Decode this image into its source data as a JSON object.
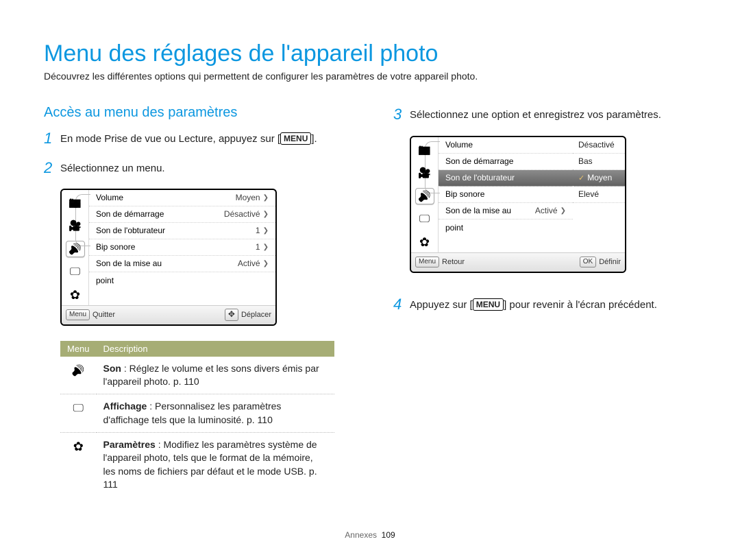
{
  "title": "Menu des réglages de l'appareil photo",
  "intro": "Découvrez les différentes options qui permettent de configurer les paramètres de votre appareil photo.",
  "subhead": "Accès au menu des paramètres",
  "steps": {
    "s1a": "En mode Prise de vue ou Lecture, appuyez sur [",
    "s1b": "].",
    "menu_btn": "MENU",
    "s2": "Sélectionnez un menu.",
    "s3": "Sélectionnez une option et enregistrez vos paramètres.",
    "s4a": "Appuyez sur [",
    "s4b": "] pour revenir à l'écran précédent."
  },
  "screen1": {
    "rows": [
      {
        "label": "Volume",
        "value": "Moyen",
        "chev": true
      },
      {
        "label": "Son de démarrage",
        "value": "Désactivé",
        "chev": true
      },
      {
        "label": "Son de l'obturateur",
        "value": "1",
        "chev": true
      },
      {
        "label": "Bip sonore",
        "value": "1",
        "chev": true
      },
      {
        "label": "Son de la mise au",
        "value": "Activé",
        "chev": true
      },
      {
        "label": "point",
        "value": "",
        "chev": false
      }
    ],
    "footer_left_btn": "Menu",
    "footer_left": "Quitter",
    "footer_right": "Déplacer"
  },
  "screen2": {
    "rows": [
      {
        "label": "Volume",
        "value": ""
      },
      {
        "label": "Son de démarrage",
        "value": ""
      },
      {
        "label": "Son de l'obturateur",
        "value": "",
        "active": true
      },
      {
        "label": "Bip sonore",
        "value": ""
      },
      {
        "label": "Son de la mise au",
        "value": "Activé",
        "chev": true
      },
      {
        "label": "point",
        "value": ""
      }
    ],
    "options": [
      "Désactivé",
      "Bas",
      "Moyen",
      "Elevé"
    ],
    "options_active_index": 2,
    "footer_left_btn": "Menu",
    "footer_left": "Retour",
    "footer_right_btn": "OK",
    "footer_right": "Définir"
  },
  "table": {
    "h1": "Menu",
    "h2": "Description",
    "rows": [
      {
        "icon": "sound",
        "bold": "Son",
        "rest": " : Réglez le volume et les sons divers émis par l'appareil photo. p. 110"
      },
      {
        "icon": "display",
        "bold": "Affichage",
        "rest": " : Personnalisez les paramètres d'affichage tels que la luminosité. p. 110"
      },
      {
        "icon": "gear",
        "bold": "Paramètres",
        "rest": " : Modifiez les paramètres système de l'appareil photo, tels que le format de la mémoire, les noms de fichiers par défaut et le mode USB. p. 111"
      }
    ]
  },
  "page_section": "Annexes",
  "page_num": "109"
}
